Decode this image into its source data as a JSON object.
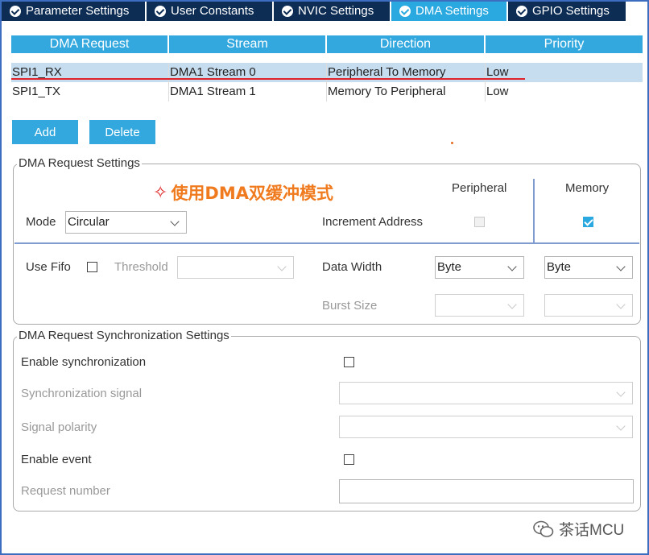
{
  "tabs": [
    {
      "label": "Parameter Settings"
    },
    {
      "label": "User Constants"
    },
    {
      "label": "NVIC Settings"
    },
    {
      "label": "DMA Settings"
    },
    {
      "label": "GPIO Settings"
    }
  ],
  "active_tab": "DMA Settings",
  "table": {
    "headers": [
      "DMA Request",
      "Stream",
      "Direction",
      "Priority"
    ],
    "rows": [
      [
        "SPI1_RX",
        "DMA1 Stream 0",
        "Peripheral To Memory",
        "Low"
      ],
      [
        "SPI1_TX",
        "DMA1 Stream 1",
        "Memory To Peripheral",
        "Low"
      ]
    ]
  },
  "buttons": {
    "add": "Add",
    "delete": "Delete"
  },
  "annotation": "使用DMA双缓冲模式",
  "dma_request_settings": {
    "title": "DMA Request Settings",
    "peripheral_header": "Peripheral",
    "memory_header": "Memory",
    "mode_label": "Mode",
    "mode_value": "Circular",
    "increment_address_label": "Increment Address",
    "peripheral_increment": false,
    "memory_increment": true,
    "use_fifo_label": "Use Fifo",
    "use_fifo": false,
    "threshold_label": "Threshold",
    "threshold_value": "",
    "data_width_label": "Data Width",
    "peripheral_data_width": "Byte",
    "memory_data_width": "Byte",
    "burst_size_label": "Burst Size",
    "peripheral_burst_size": "",
    "memory_burst_size": ""
  },
  "sync_settings": {
    "title": "DMA Request Synchronization Settings",
    "enable_sync_label": "Enable synchronization",
    "enable_sync": false,
    "sync_signal_label": "Synchronization signal",
    "sync_signal_value": "",
    "signal_polarity_label": "Signal polarity",
    "signal_polarity_value": "",
    "enable_event_label": "Enable event",
    "enable_event": false,
    "request_number_label": "Request number",
    "request_number_value": ""
  },
  "watermark": "茶话MCU",
  "colors": {
    "tab_bg": "#0d2d55",
    "tab_active": "#2aa9e0",
    "header_bg": "#33a8de",
    "selected_row": "#c6dcef",
    "highlight_line": "#e0222a",
    "annotation": "#f07a1e"
  }
}
